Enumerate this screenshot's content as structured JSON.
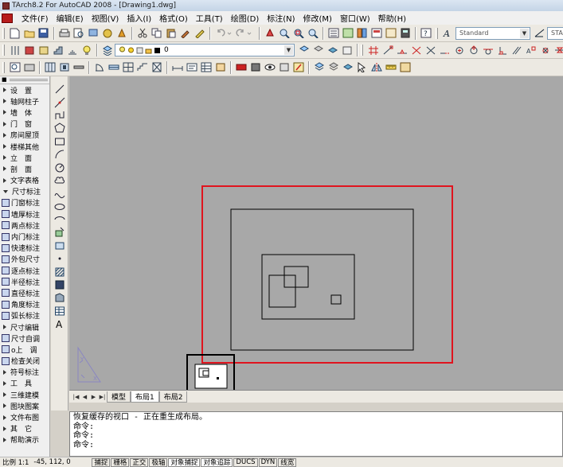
{
  "window": {
    "title": "TArch8.2 For AutoCAD 2008 - [Drawing1.dwg]"
  },
  "menubar": {
    "items": [
      "文件(F)",
      "编辑(E)",
      "视图(V)",
      "插入(I)",
      "格式(O)",
      "工具(T)",
      "绘图(D)",
      "标注(N)",
      "修改(M)",
      "窗口(W)",
      "帮助(H)"
    ]
  },
  "toolbar": {
    "text_style": "Standard",
    "dim_style": "STANDAR",
    "layer_value": "0"
  },
  "tarch_panel": {
    "items": [
      {
        "label": "设　置",
        "type": "cat"
      },
      {
        "label": "轴网柱子",
        "type": "cat"
      },
      {
        "label": "墙　体",
        "type": "cat"
      },
      {
        "label": "门　窗",
        "type": "cat"
      },
      {
        "label": "房间屋顶",
        "type": "cat"
      },
      {
        "label": "楼梯其他",
        "type": "cat"
      },
      {
        "label": "立　面",
        "type": "cat"
      },
      {
        "label": "剖　面",
        "type": "cat"
      },
      {
        "label": "文字表格",
        "type": "cat"
      },
      {
        "label": "尺寸标注",
        "type": "open"
      },
      {
        "label": "门窗标注",
        "type": "sub"
      },
      {
        "label": "墙厚标注",
        "type": "sub"
      },
      {
        "label": "两点标注",
        "type": "sub"
      },
      {
        "label": "内门标注",
        "type": "sub"
      },
      {
        "label": "快速标注",
        "type": "sub"
      },
      {
        "label": "外包尺寸",
        "type": "sub"
      },
      {
        "label": "逐点标注",
        "type": "sub"
      },
      {
        "label": "半径标注",
        "type": "sub"
      },
      {
        "label": "直径标注",
        "type": "sub"
      },
      {
        "label": "角度标注",
        "type": "sub"
      },
      {
        "label": "弧长标注",
        "type": "sub"
      },
      {
        "label": "尺寸编辑",
        "type": "cat"
      },
      {
        "label": "尺寸自调",
        "type": "sub"
      },
      {
        "label": "o上　调",
        "type": "sub"
      },
      {
        "label": "检查关闭",
        "type": "sub"
      },
      {
        "label": "符号标注",
        "type": "cat"
      },
      {
        "label": "工　具",
        "type": "cat"
      },
      {
        "label": "三维建模",
        "type": "cat"
      },
      {
        "label": "图块图案",
        "type": "cat"
      },
      {
        "label": "文件布图",
        "type": "cat"
      },
      {
        "label": "其　它",
        "type": "cat"
      },
      {
        "label": "帮助演示",
        "type": "cat"
      }
    ]
  },
  "draw_tools": {
    "icons": [
      "line-icon",
      "construction-line-icon",
      "polyline-icon",
      "polygon-icon",
      "rectangle-icon",
      "arc-icon",
      "circle-icon",
      "revision-cloud-icon",
      "spline-icon",
      "ellipse-icon",
      "ellipse-arc-icon",
      "insert-block-icon",
      "make-block-icon",
      "point-icon",
      "hatch-icon",
      "gradient-icon",
      "region-icon",
      "table-icon",
      "mtext-icon"
    ],
    "text_tool": "A"
  },
  "layout_tabs": [
    "模型",
    "布局1",
    "布局2"
  ],
  "layout_tabs_active": 1,
  "command": {
    "lines": [
      "恢复缓存的视口 - 正在重生成布局。",
      "命令:",
      "命令:",
      "命令:"
    ]
  },
  "statusbar": {
    "scale": "比例 1:1",
    "coords": "-45, 112, 0",
    "toggles": [
      "捕捉",
      "栅格",
      "正交",
      "极轴",
      "对象捕捉",
      "对象追踪",
      "DUCS",
      "DYN",
      "线宽"
    ],
    "active_toggles": [
      4,
      5
    ]
  },
  "colors": {
    "canvas_bg": "#a8a8a8",
    "viewport_frame": "#e0141e",
    "drawing_lines": "#000000"
  }
}
